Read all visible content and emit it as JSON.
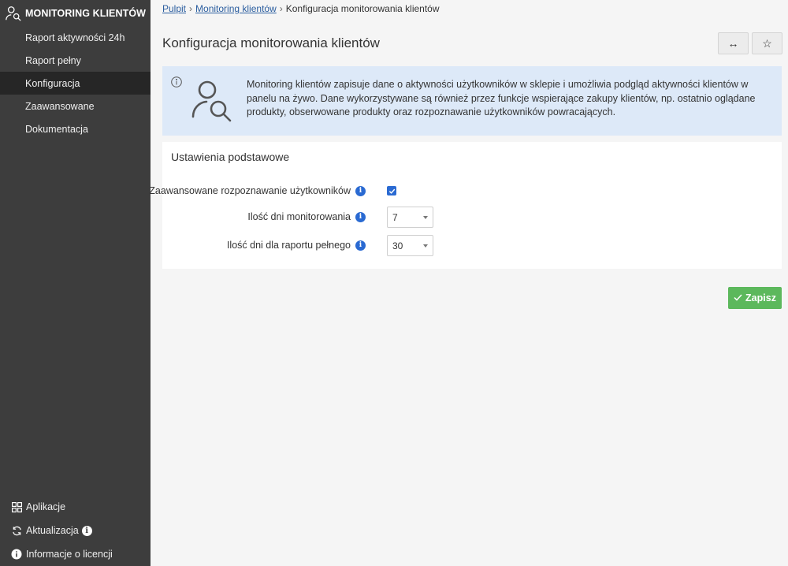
{
  "sidebar": {
    "title": "MONITORING KLIENTÓW",
    "items": [
      {
        "label": "Raport aktywności 24h",
        "active": false
      },
      {
        "label": "Raport pełny",
        "active": false
      },
      {
        "label": "Konfiguracja",
        "active": true
      },
      {
        "label": "Zaawansowane",
        "active": false
      },
      {
        "label": "Dokumentacja",
        "active": false
      }
    ],
    "bottom": [
      {
        "label": "Aplikacje",
        "icon": "grid-icon"
      },
      {
        "label": "Aktualizacja",
        "icon": "refresh-icon"
      },
      {
        "label": "Informacje o licencji",
        "icon": "info-icon"
      }
    ]
  },
  "breadcrumb": {
    "items": [
      "Pulpit",
      "Monitoring klientów"
    ],
    "current": "Konfiguracja monitorowania klientów",
    "separator": "›"
  },
  "page": {
    "title": "Konfiguracja monitorowania klientów",
    "expand_icon": "↔",
    "star_icon": "☆"
  },
  "info": {
    "text": "Monitoring klientów zapisuje dane o aktywności użytkowników w sklepie i umożliwia podgląd aktywności klientów w panelu na żywo. Dane wykorzystywane są również przez funkcje wspierające zakupy klientów, np. ostatnio oglądane produkty, obserwowane produkty oraz rozpoznawanie użytkowników powracających."
  },
  "settings": {
    "title": "Ustawienia podstawowe",
    "advanced_recognition": {
      "label": "Zaawansowane rozpoznawanie użytkowników",
      "checked": true
    },
    "monitor_days": {
      "label": "Ilość dni monitorowania",
      "value": "7"
    },
    "report_days": {
      "label": "Ilość dni dla raportu pełnego",
      "value": "30"
    }
  },
  "actions": {
    "save_label": "Zapisz"
  },
  "colors": {
    "sidebar_bg": "#3d3d3d",
    "accent_blue": "#2a6ad2",
    "save_green": "#5cb85c",
    "info_bg": "#dde9f8"
  }
}
